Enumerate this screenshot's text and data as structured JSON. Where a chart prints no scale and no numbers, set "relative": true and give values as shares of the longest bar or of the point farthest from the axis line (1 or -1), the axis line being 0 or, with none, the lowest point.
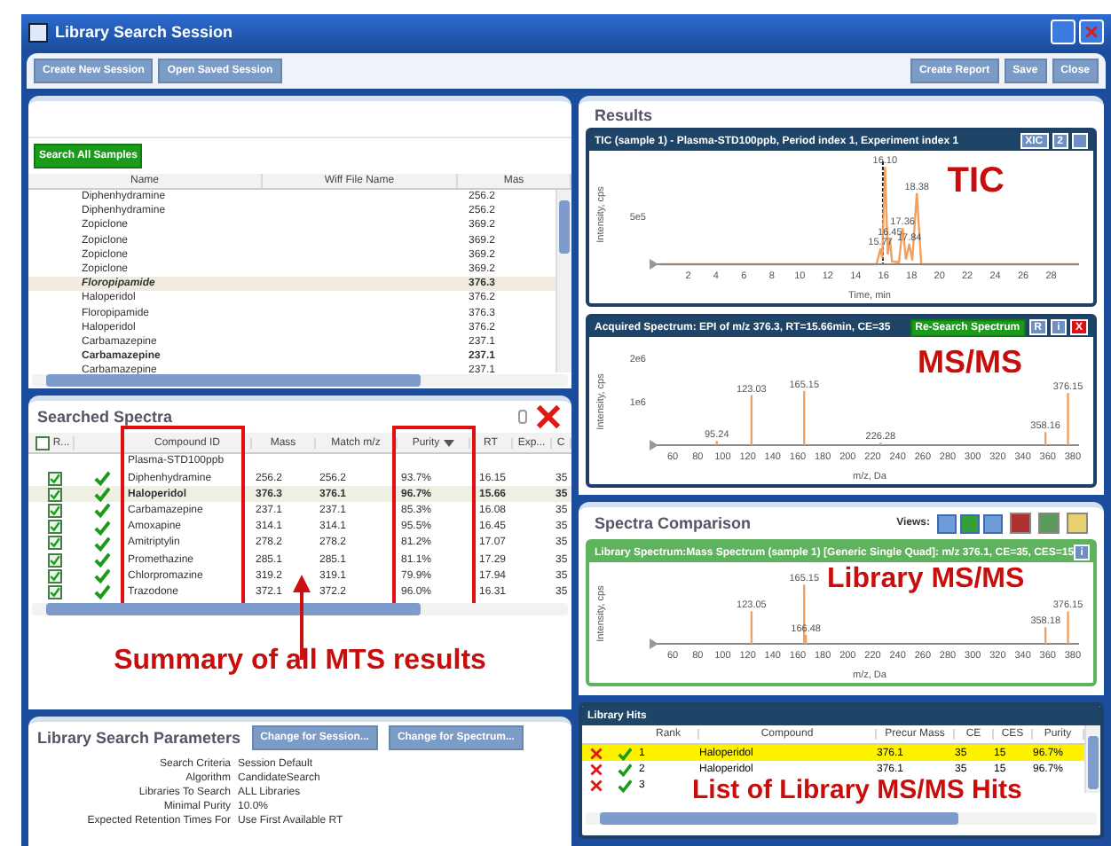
{
  "window": {
    "title": "Library Search Session"
  },
  "toolbar": {
    "left_buttons": [
      "Create New Session",
      "Open Saved Session"
    ],
    "right_buttons": [
      "Create Report",
      "Save",
      "Close"
    ]
  },
  "samples": {
    "button": "Search All Samples",
    "columns": [
      "Name",
      "Wiff File Name",
      "Mas"
    ],
    "rows": [
      {
        "name": "Diphenhydramine",
        "mass": "256.2",
        "emphasized": false,
        "selected": false
      },
      {
        "name": "Diphenhydramine",
        "mass": "256.2",
        "emphasized": false,
        "selected": false
      },
      {
        "name": "Zopiclone",
        "mass": "369.2",
        "emphasized": false,
        "selected": false
      },
      {
        "name": "Zopiclone",
        "mass": "369.2",
        "emphasized": false,
        "selected": false
      },
      {
        "name": "Zopiclone",
        "mass": "369.2",
        "emphasized": false,
        "selected": false
      },
      {
        "name": "Zopiclone",
        "mass": "369.2",
        "emphasized": false,
        "selected": false
      },
      {
        "name": "Floropipamide",
        "mass": "376.3",
        "emphasized": true,
        "selected": true
      },
      {
        "name": "Haloperidol",
        "mass": "376.2",
        "emphasized": false,
        "selected": false
      },
      {
        "name": "Floropipamide",
        "mass": "376.3",
        "emphasized": false,
        "selected": false
      },
      {
        "name": "Haloperidol",
        "mass": "376.2",
        "emphasized": false,
        "selected": false
      },
      {
        "name": "Carbamazepine",
        "mass": "237.1",
        "emphasized": false,
        "selected": false
      },
      {
        "name": "Carbamazepine",
        "mass": "237.1",
        "emphasized": true,
        "selected": false
      },
      {
        "name": "Carbamazepine",
        "mass": "237.1",
        "emphasized": false,
        "selected": false
      }
    ]
  },
  "searched_spectra": {
    "title": "Searched Spectra",
    "columns": [
      {
        "label": "R...",
        "sorted": false
      },
      {
        "label": "Compound ID",
        "sorted": false
      },
      {
        "label": "Mass",
        "sorted": false
      },
      {
        "label": "Match m/z",
        "sorted": false
      },
      {
        "label": "Purity",
        "sorted": true
      },
      {
        "label": "RT",
        "sorted": false
      },
      {
        "label": "Exp...",
        "sorted": false
      },
      {
        "label": "C",
        "sorted": false
      }
    ],
    "group": "Plasma-STD100ppb",
    "rows": [
      {
        "checked": true,
        "hit": true,
        "selected": false,
        "compound": "Diphenhydramine",
        "mass": "256.2",
        "match": "256.2",
        "purity": "93.7%",
        "rt": "16.15",
        "column_9": "35"
      },
      {
        "checked": true,
        "hit": true,
        "selected": true,
        "compound": "Haloperidol",
        "mass": "376.3",
        "match": "376.1",
        "purity": "96.7%",
        "rt": "15.66",
        "column_9": "35"
      },
      {
        "checked": true,
        "hit": true,
        "selected": false,
        "compound": "Carbamazepine",
        "mass": "237.1",
        "match": "237.1",
        "purity": "85.3%",
        "rt": "16.08",
        "column_9": "35"
      },
      {
        "checked": true,
        "hit": true,
        "selected": false,
        "compound": "Amoxapine",
        "mass": "314.1",
        "match": "314.1",
        "purity": "95.5%",
        "rt": "16.45",
        "column_9": "35"
      },
      {
        "checked": true,
        "hit": true,
        "selected": false,
        "compound": "Amitriptylin",
        "mass": "278.2",
        "match": "278.2",
        "purity": "81.2%",
        "rt": "17.07",
        "column_9": "35"
      },
      {
        "checked": true,
        "hit": true,
        "selected": false,
        "compound": "Promethazine",
        "mass": "285.1",
        "match": "285.1",
        "purity": "81.1%",
        "rt": "17.29",
        "column_9": "35"
      },
      {
        "checked": true,
        "hit": true,
        "selected": false,
        "compound": "Chlorpromazine",
        "mass": "319.2",
        "match": "319.1",
        "purity": "79.9%",
        "rt": "17.94",
        "column_9": "35"
      },
      {
        "checked": true,
        "hit": true,
        "selected": false,
        "compound": "Trazodone",
        "mass": "372.1",
        "match": "372.2",
        "purity": "96.0%",
        "rt": "16.31",
        "column_9": "35"
      }
    ],
    "annotation": "Summary of all MTS results"
  },
  "parameters": {
    "title": "Library Search Parameters",
    "buttons": [
      "Change for Session...",
      "Change for Spectrum..."
    ],
    "items": [
      {
        "label": "Search Criteria",
        "value": "Session Default"
      },
      {
        "label": "Algorithm",
        "value": "CandidateSearch"
      },
      {
        "label": "Libraries To Search",
        "value": "ALL Libraries"
      },
      {
        "label": "Minimal Purity",
        "value": "10.0%"
      },
      {
        "label": "Expected Retention Times For",
        "value": "Use First Available RT"
      }
    ]
  },
  "results": {
    "title": "Results",
    "tic": {
      "title": "TIC  (sample 1) - Plasma-STD100ppb,  Period index 1, Experiment index 1",
      "buttons": [
        "XIC",
        "2"
      ],
      "annotation": "TIC",
      "chart_data": {
        "type": "line",
        "xlabel": "Time, min",
        "ylabel": "Intensity, cps",
        "x": [
          0,
          15.5,
          15.77,
          15.9,
          16.1,
          16.3,
          16.45,
          16.6,
          17.1,
          17.36,
          17.6,
          17.84,
          18.05,
          18.38,
          18.7,
          30
        ],
        "series": [
          {
            "color": "#f0a060",
            "values": [
              0,
              0,
              0.16,
              0.06,
              1,
              0.1,
              0.26,
              0.03,
              0.02,
              0.37,
              0.05,
              0.21,
              0.04,
              0.73,
              0,
              0
            ]
          }
        ],
        "relative": true,
        "xlim": [
          0,
          30
        ],
        "xticks": [
          2,
          4,
          6,
          8,
          10,
          12,
          14,
          16,
          18,
          20,
          22,
          24,
          26,
          28
        ],
        "ref_lines": [
          {
            "axis": "x",
            "value": 15.95
          }
        ],
        "annotations": [
          "5e5",
          {
            "x": 15.77,
            "y": 0.16,
            "text": "15.77"
          },
          {
            "x": 16.45,
            "y": 0.26,
            "text": "16.45"
          },
          {
            "x": 16.1,
            "y": 1,
            "text": "16.10"
          },
          {
            "x": 17.36,
            "y": 0.37,
            "text": "17.36"
          },
          {
            "x": 17.84,
            "y": 0.21,
            "text": "17.84"
          },
          {
            "x": 18.38,
            "y": 0.73,
            "text": "18.38"
          }
        ]
      }
    },
    "spectrum": {
      "title": "Acquired Spectrum: EPI of m/z 376.3, RT=15.66min, CE=35",
      "button": "Re-Search Spectrum",
      "icon_buttons": [
        "R",
        "i",
        "X"
      ],
      "annotation": "MS/MS",
      "chart_data": {
        "type": "bar",
        "xlabel": "m/z, Da",
        "ylabel": "Intensity, cps",
        "x": [
          95.24,
          123.03,
          165.15,
          226.28,
          358.16,
          376.15
        ],
        "series": [
          {
            "color": "#f0a060",
            "values": [
              100000,
              1150000,
              1250000,
              60000,
              300000,
              1200000
            ]
          }
        ],
        "xlim": [
          50,
          385
        ],
        "ylim": [
          0,
          2000000
        ],
        "xticks": [
          60,
          80,
          100,
          120,
          140,
          160,
          180,
          200,
          220,
          240,
          260,
          280,
          300,
          320,
          340,
          360,
          380
        ],
        "yticks": [
          {
            "value": 1000000,
            "label": "1e6"
          },
          {
            "value": 2000000,
            "label": "2e6"
          }
        ],
        "value_labels": [
          "95.24",
          "123.03",
          "165.15",
          "226.28",
          "358.16",
          "376.15"
        ]
      }
    }
  },
  "comparison": {
    "title": "Spectra Comparison",
    "views_label": "Views:",
    "library": {
      "title": "Library Spectrum:Mass Spectrum (sample 1) [Generic Single Quad]: m/z 376.1, CE=35, CES=15",
      "info": "i",
      "annotation": "Library MS/MS",
      "chart_data": {
        "type": "bar",
        "xlabel": "m/z, Da",
        "ylabel": "Intensity, cps",
        "x": [
          123.05,
          165.15,
          166.48,
          358.18,
          376.15
        ],
        "series": [
          {
            "color": "#f0a060",
            "values": [
              0.55,
              1,
              0.15,
              0.28,
              0.55
            ]
          }
        ],
        "relative": true,
        "xlim": [
          50,
          385
        ],
        "xticks": [
          60,
          80,
          100,
          120,
          140,
          160,
          180,
          200,
          220,
          240,
          260,
          280,
          300,
          320,
          340,
          360,
          380
        ],
        "value_labels": [
          "123.05",
          "165.15",
          "166.48",
          "358.18",
          "376.15"
        ]
      }
    }
  },
  "hits": {
    "title": "Library Hits",
    "columns": [
      "Rank",
      "Compound",
      "Precur Mass",
      "CE",
      "CES",
      "Purity"
    ],
    "rows": [
      {
        "selected": true,
        "rank": "1",
        "compound": "Haloperidol",
        "mass": "376.1",
        "ce": "35",
        "ces": "15",
        "purity": "96.7%"
      },
      {
        "selected": false,
        "rank": "2",
        "compound": "Haloperidol",
        "mass": "376.1",
        "ce": "35",
        "ces": "15",
        "purity": "96.7%"
      },
      {
        "selected": false,
        "rank": "3"
      }
    ],
    "annotation": "List of Library MS/MS Hits"
  }
}
